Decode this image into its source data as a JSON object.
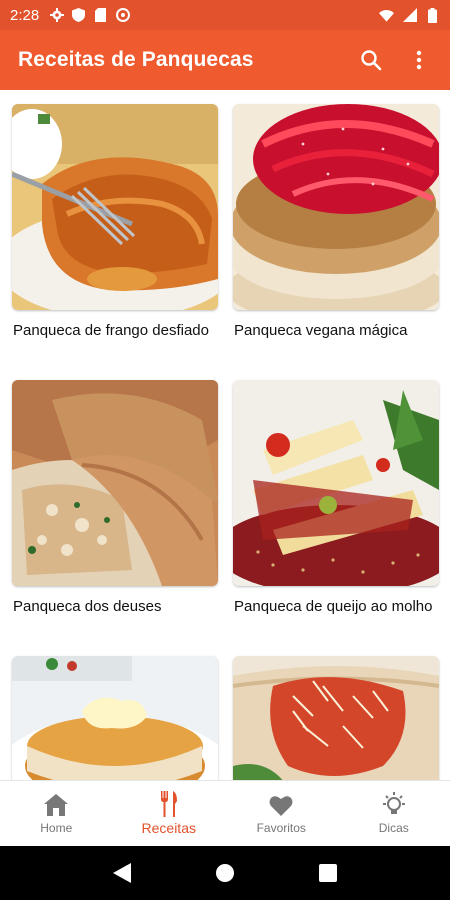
{
  "status_bar": {
    "time": "2:28",
    "icons_left": [
      "gear-icon",
      "shield-icon",
      "sd-card-icon",
      "location-off-icon"
    ],
    "icons_right": [
      "wifi-icon",
      "signal-icon",
      "battery-icon"
    ]
  },
  "app_bar": {
    "title": "Receitas de Panquecas",
    "actions": [
      "search-icon",
      "more-vert-icon"
    ],
    "color": "#f05a2f"
  },
  "recipes": [
    {
      "title": "Panqueca de frango desfiado"
    },
    {
      "title": "Panqueca vegana mágica"
    },
    {
      "title": "Panqueca dos deuses"
    },
    {
      "title": "Panqueca de queijo ao molho"
    },
    {
      "title": ""
    },
    {
      "title": ""
    }
  ],
  "bottom_nav": {
    "items": [
      {
        "label": "Home",
        "icon": "home-icon"
      },
      {
        "label": "Receitas",
        "icon": "fork-knife-icon"
      },
      {
        "label": "Favoritos",
        "icon": "heart-icon"
      },
      {
        "label": "Dicas",
        "icon": "lightbulb-icon"
      }
    ],
    "active": "Receitas",
    "accent": "#e2522c"
  },
  "system_nav": [
    "back-icon",
    "home-circle-icon",
    "recents-icon"
  ]
}
